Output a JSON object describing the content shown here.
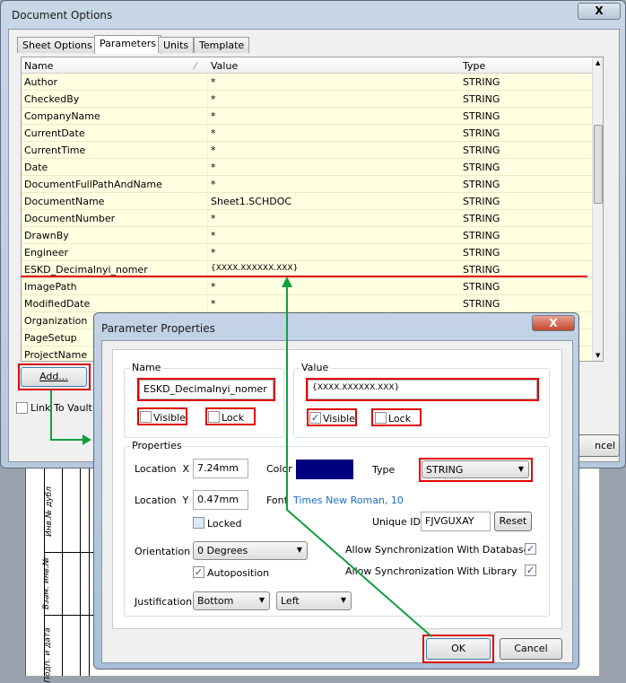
{
  "outer": {
    "title": "Document Options",
    "close": "X",
    "tabs": [
      "Sheet Options",
      "Parameters",
      "Units",
      "Template"
    ],
    "columns": [
      "Name",
      "Value",
      "Type"
    ],
    "rows": [
      [
        "Author",
        "*",
        "STRING"
      ],
      [
        "CheckedBy",
        "*",
        "STRING"
      ],
      [
        "CompanyName",
        "*",
        "STRING"
      ],
      [
        "CurrentDate",
        "*",
        "STRING"
      ],
      [
        "CurrentTime",
        "*",
        "STRING"
      ],
      [
        "Date",
        "*",
        "STRING"
      ],
      [
        "DocumentFullPathAndName",
        "*",
        "STRING"
      ],
      [
        "DocumentName",
        "Sheet1.SCHDOC",
        "STRING"
      ],
      [
        "DocumentNumber",
        "*",
        "STRING"
      ],
      [
        "DrawnBy",
        "*",
        "STRING"
      ],
      [
        "Engineer",
        "*",
        "STRING"
      ],
      [
        "ESKD_Decimalnyi_nomer",
        "{XXXX.XXXXXX.XXX}",
        "STRING"
      ],
      [
        "ImagePath",
        "*",
        "STRING"
      ],
      [
        "ModifiedDate",
        "*",
        "STRING"
      ],
      [
        "Organization",
        "",
        ""
      ],
      [
        "PageSetup",
        "",
        ""
      ],
      [
        "ProjectName",
        "",
        ""
      ]
    ],
    "add_button": "Add...",
    "link_to_vault": "Link To Vault",
    "cancel_partial": "ncel"
  },
  "sheet": {
    "labels": [
      "Инв.№ дубл",
      "Взам. инв.№",
      "Подп. и дата"
    ]
  },
  "dialog": {
    "title": "Parameter Properties",
    "close": "X",
    "name_group": "Name",
    "name_value": "ESKD_Decimalnyi_nomer",
    "name_visible": "Visible",
    "name_lock": "Lock",
    "value_group": "Value",
    "value_value": "{XXXX.XXXXXX.XXX}",
    "value_visible": "Visible",
    "value_lock": "Lock",
    "properties": "Properties",
    "location_x_label": "Location  X",
    "location_x": "7.24mm",
    "color_label": "Color",
    "color": "#000080",
    "type_label": "Type",
    "type": "STRING",
    "location_y_label": "Location  Y",
    "location_y": "0.47mm",
    "font_label": "Font",
    "font": "Times New Roman, 10",
    "locked": "Locked",
    "unique_id_label": "Unique ID",
    "unique_id": "FJVGUXAY",
    "reset": "Reset",
    "orientation_label": "Orientation",
    "orientation": "0 Degrees",
    "autoposition": "Autoposition",
    "sync_db": "Allow Synchronization With Database",
    "sync_lib": "Allow Synchronization With Library",
    "justification_label": "Justification",
    "just_v": "Bottom",
    "just_h": "Left",
    "ok": "OK",
    "cancel": "Cancel",
    "checks": {
      "name_visible": false,
      "name_lock": false,
      "value_visible": true,
      "value_lock": false,
      "locked": false,
      "autoposition": true,
      "sync_db": true,
      "sync_lib": true
    }
  },
  "colors": {
    "highlight": "#e00000",
    "arrow": "#10a040",
    "row_bg": "#ffffe1",
    "font_link": "#1a6fc4"
  }
}
